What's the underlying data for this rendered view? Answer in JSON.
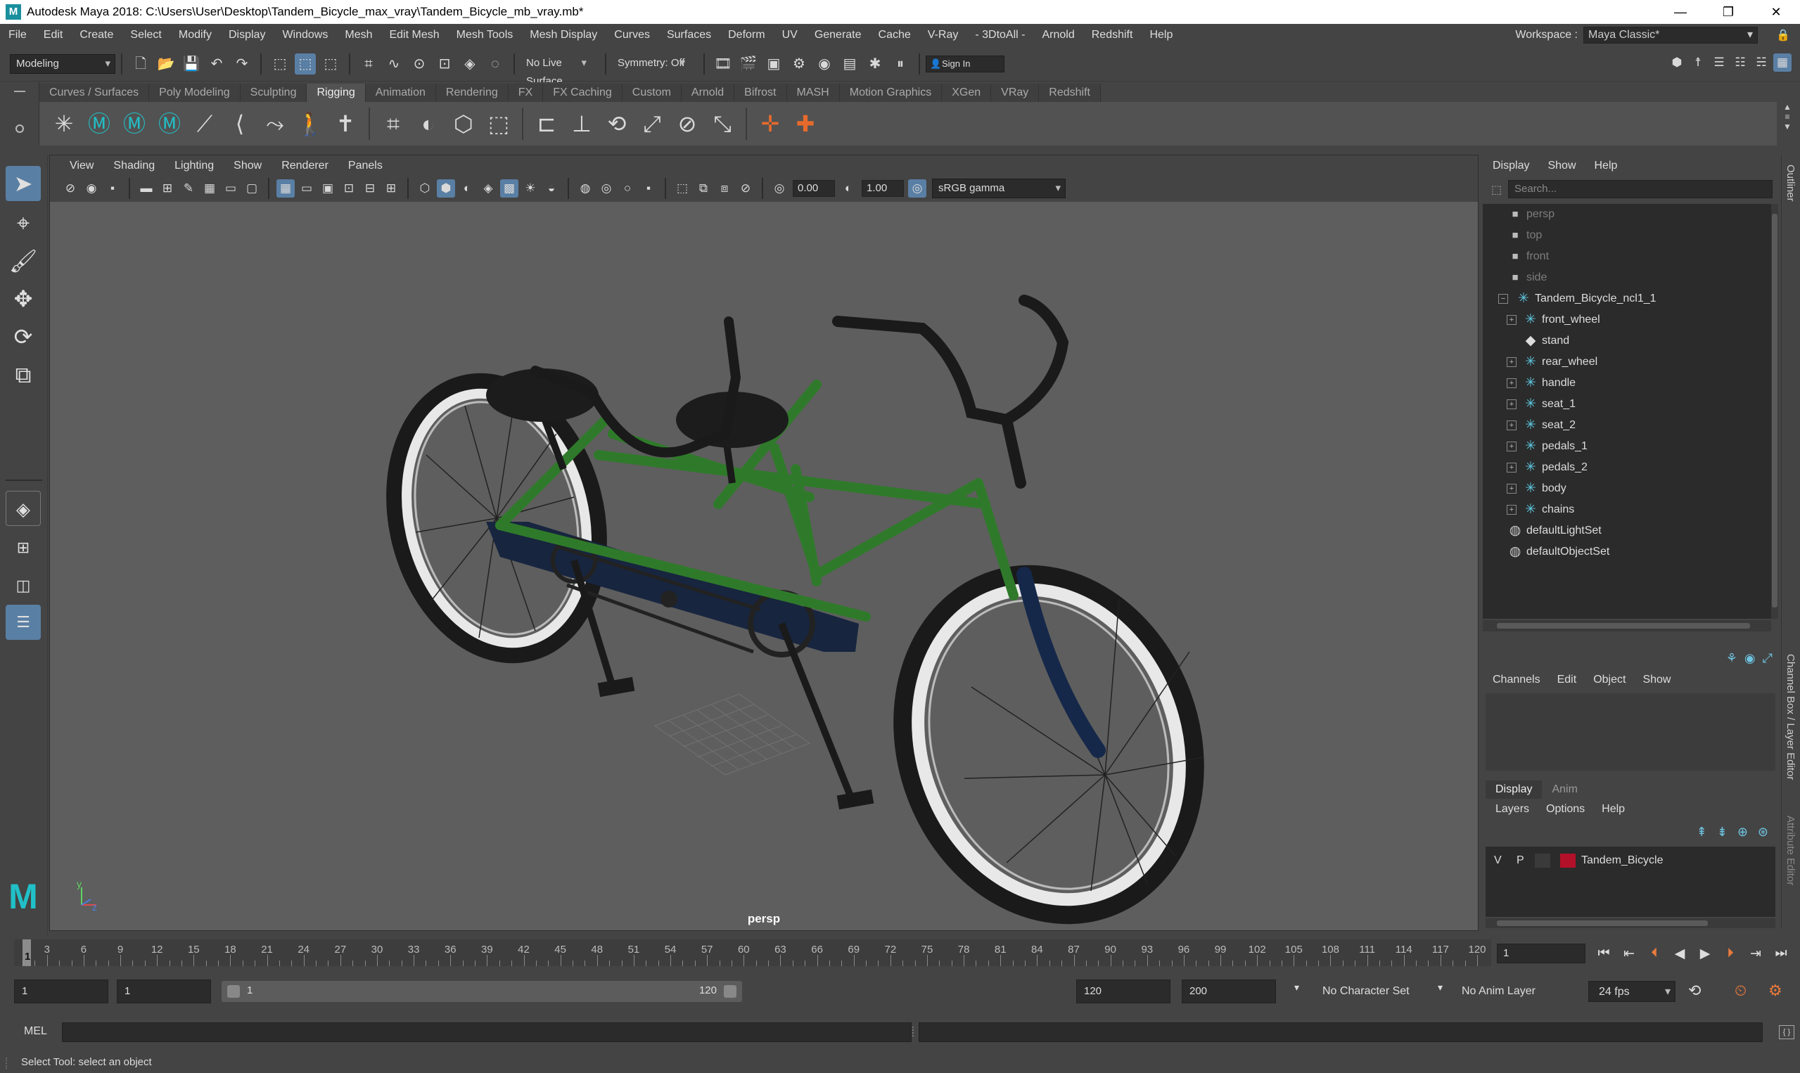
{
  "window": {
    "title": "Autodesk Maya 2018: C:\\Users\\User\\Desktop\\Tandem_Bicycle_max_vray\\Tandem_Bicycle_mb_vray.mb*",
    "minimize": "—",
    "maximize": "❐",
    "close": "✕"
  },
  "menubar": {
    "items": [
      "File",
      "Edit",
      "Create",
      "Select",
      "Modify",
      "Display",
      "Windows",
      "Mesh",
      "Edit Mesh",
      "Mesh Tools",
      "Mesh Display",
      "Curves",
      "Surfaces",
      "Deform",
      "UV",
      "Generate",
      "Cache",
      "V-Ray",
      "- 3DtoAll -",
      "Arnold",
      "Redshift",
      "Help"
    ],
    "workspace_label": "Workspace :",
    "workspace_value": "Maya Classic*"
  },
  "statusline": {
    "mode": "Modeling",
    "live_surface": "No Live Surface",
    "symmetry": "Symmetry: Off",
    "sign_in": "Sign In"
  },
  "shelf": {
    "tabs": [
      "Curves / Surfaces",
      "Poly Modeling",
      "Sculpting",
      "Rigging",
      "Animation",
      "Rendering",
      "FX",
      "FX Caching",
      "Custom",
      "Arnold",
      "Bifrost",
      "MASH",
      "Motion Graphics",
      "XGen",
      "VRay",
      "Redshift"
    ],
    "active_tab": "Rigging"
  },
  "viewport": {
    "menu": [
      "View",
      "Shading",
      "Lighting",
      "Show",
      "Renderer",
      "Panels"
    ],
    "exposure": "0.00",
    "gamma_value": "1.00",
    "color_space": "sRGB gamma",
    "camera_label": "persp",
    "axis_y": "y",
    "axis_z": "z"
  },
  "outliner": {
    "menu": [
      "Display",
      "Show",
      "Help"
    ],
    "search_placeholder": "Search...",
    "items": [
      {
        "label": "persp",
        "icon": "camera-icon",
        "dim": true
      },
      {
        "label": "top",
        "icon": "camera-icon",
        "dim": true
      },
      {
        "label": "front",
        "icon": "camera-icon",
        "dim": true
      },
      {
        "label": "side",
        "icon": "camera-icon",
        "dim": true
      },
      {
        "label": "Tandem_Bicycle_ncl1_1",
        "icon": "group-icon",
        "dim": false,
        "expanded": true
      },
      {
        "label": "front_wheel",
        "icon": "group-icon",
        "dim": false
      },
      {
        "label": "stand",
        "icon": "mesh-icon",
        "dim": false
      },
      {
        "label": "rear_wheel",
        "icon": "group-icon",
        "dim": false
      },
      {
        "label": "handle",
        "icon": "group-icon",
        "dim": false
      },
      {
        "label": "seat_1",
        "icon": "group-icon",
        "dim": false
      },
      {
        "label": "seat_2",
        "icon": "group-icon",
        "dim": false
      },
      {
        "label": "pedals_1",
        "icon": "group-icon",
        "dim": false
      },
      {
        "label": "pedals_2",
        "icon": "group-icon",
        "dim": false
      },
      {
        "label": "body",
        "icon": "group-icon",
        "dim": false
      },
      {
        "label": "chains",
        "icon": "group-icon",
        "dim": false
      },
      {
        "label": "defaultLightSet",
        "icon": "set-icon",
        "dim": false
      },
      {
        "label": "defaultObjectSet",
        "icon": "set-icon",
        "dim": false
      }
    ]
  },
  "sidetabs": {
    "outliner": "Outliner",
    "channel_layer": "Channel Box / Layer Editor",
    "attribute": "Attribute Editor"
  },
  "channelbox": {
    "menu": [
      "Channels",
      "Edit",
      "Object",
      "Show"
    ]
  },
  "layereditor": {
    "tabs": [
      "Display",
      "Anim"
    ],
    "active_tab": "Display",
    "menu": [
      "Layers",
      "Options",
      "Help"
    ],
    "layer": {
      "visible": "V",
      "playback": "P",
      "name": "Tandem_Bicycle",
      "color": "#b3102a"
    }
  },
  "timeline": {
    "ticks": [
      3,
      6,
      9,
      12,
      15,
      18,
      21,
      24,
      27,
      30,
      33,
      36,
      39,
      42,
      45,
      48,
      51,
      54,
      57,
      60,
      63,
      66,
      69,
      72,
      75,
      78,
      81,
      84,
      87,
      90,
      93,
      96,
      99,
      102,
      105,
      108,
      111,
      114,
      117,
      120
    ],
    "min": 1,
    "max": 120,
    "current_frame": "1",
    "playhead_label": "1"
  },
  "range": {
    "start": "1",
    "anim_start": "1",
    "range_start": "1",
    "range_end": "120",
    "anim_end": "120",
    "end": "200",
    "character_set": "No Character Set",
    "anim_layer": "No Anim Layer",
    "fps": "24 fps"
  },
  "cmdline": {
    "label": "MEL"
  },
  "helpline": {
    "message": "Select Tool: select an object"
  },
  "colors": {
    "accent": "#5a7fa4",
    "maya_teal": "#21c0c8",
    "frame_green": "#2f7a2a",
    "chain_guard": "#1a2a4a"
  }
}
